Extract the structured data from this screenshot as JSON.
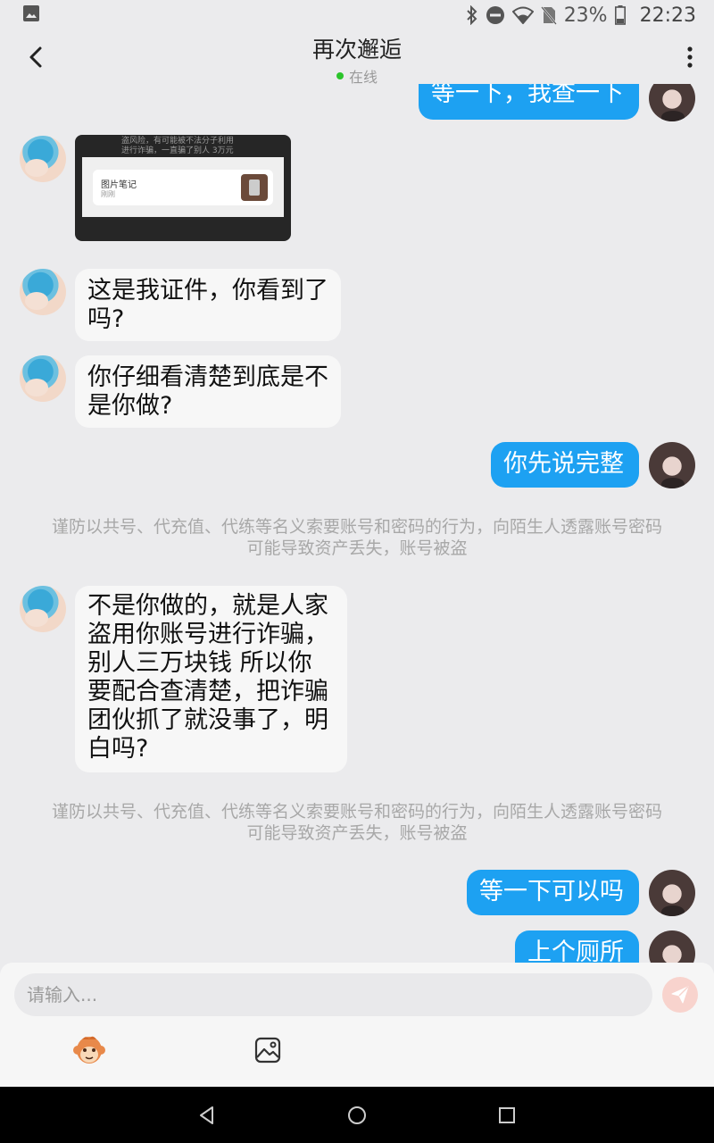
{
  "status_bar": {
    "battery_percent": "23%",
    "time": "22:23"
  },
  "header": {
    "title": "再次邂逅",
    "presence": "在线"
  },
  "messages": {
    "m0": "等一下，我查一下",
    "img": {
      "top_text_1": "盗风险，有可能被不法分子利用",
      "top_text_2": "进行诈骗，一直骗了别人 3万元",
      "card_title": "图片笔记",
      "card_sub": "刚刚"
    },
    "m2": "这是我证件，你看到了吗?",
    "m3": "你仔细看清楚到底是不是你做?",
    "m4": "你先说完整",
    "m5": "不是你做的，就是人家盗用你账号进行诈骗，别人三万块钱 所以你要配合查清楚，把诈骗团伙抓了就没事了，明白吗?",
    "m6": "等一下可以吗",
    "m7": "上个厕所"
  },
  "notice": {
    "line1": "谨防以共号、代充值、代练等名义索要账号和密码的行为，向陌生人透露账号密码",
    "line2": "可能导致资产丢失，账号被盗"
  },
  "input": {
    "placeholder": "请输入..."
  },
  "colors": {
    "outgoing_bubble": "#1da1f2",
    "incoming_bubble": "#f7f7f7",
    "online_dot": "#2bc42b",
    "background": "#ebebed"
  },
  "icons": [
    "image-icon",
    "bluetooth-icon",
    "dnd-icon",
    "wifi-icon",
    "no-sim-icon",
    "battery-icon",
    "back-arrow-icon",
    "more-vertical-icon",
    "send-icon",
    "emoji-monkey-icon",
    "image-picker-icon",
    "nav-back-icon",
    "nav-home-icon",
    "nav-recents-icon"
  ]
}
